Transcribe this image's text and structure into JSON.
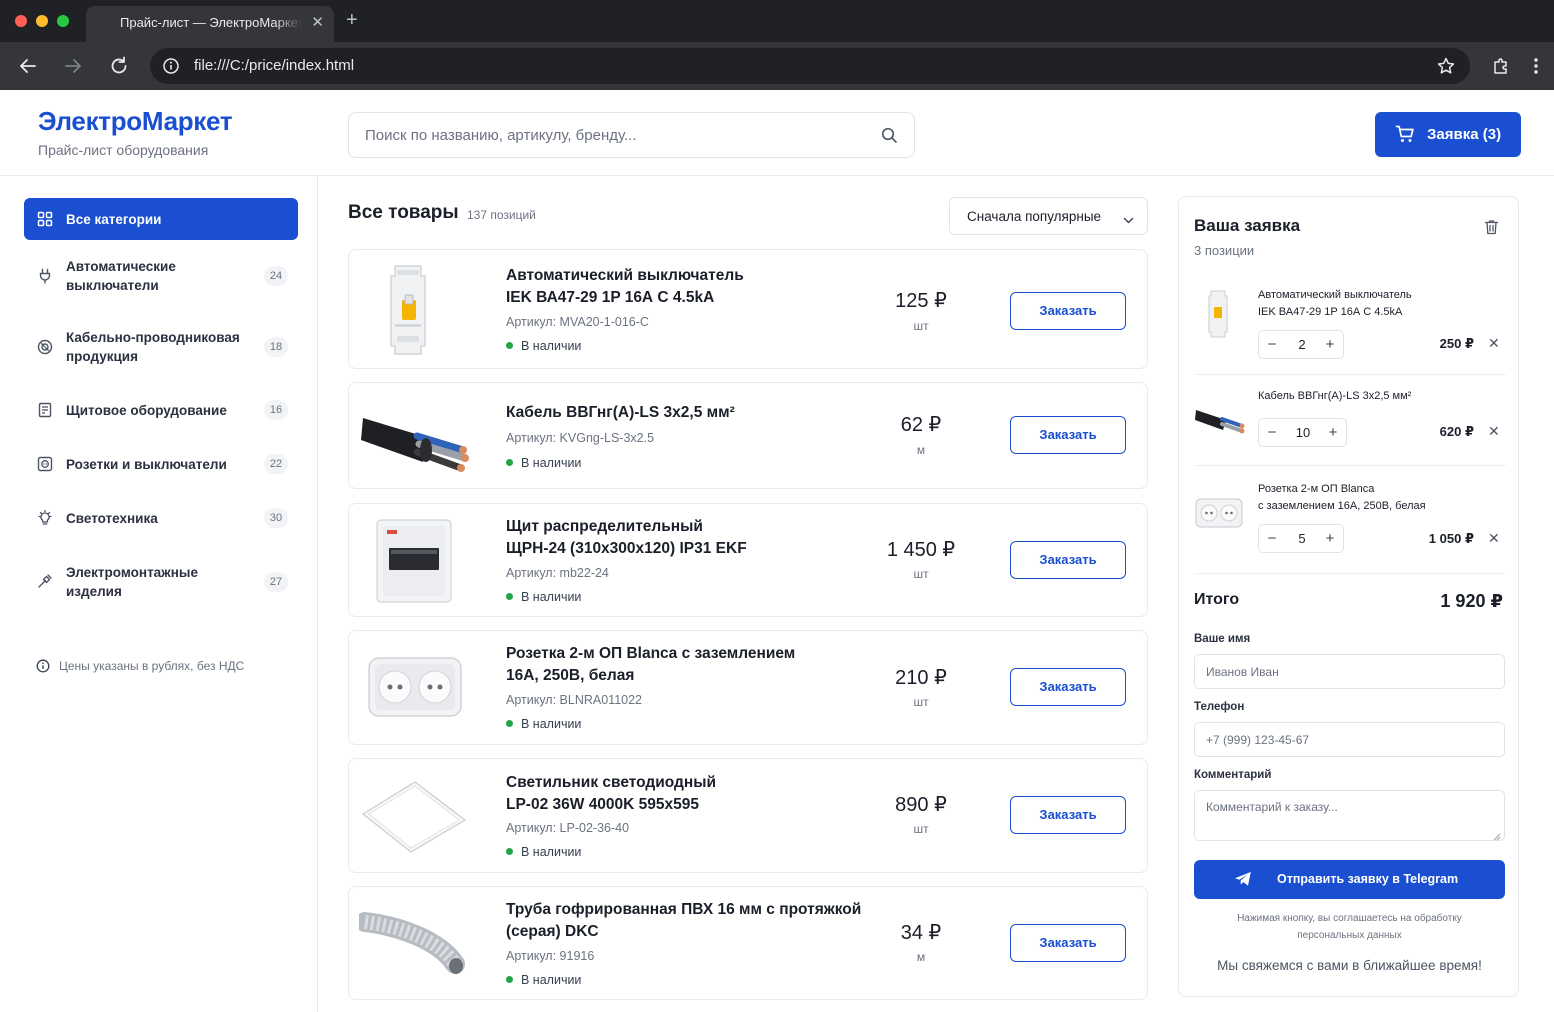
{
  "browser": {
    "tab_title": "Прайс-лист — ЭлектроМаркет",
    "tab_close": "✕",
    "new_tab": "+",
    "url": "file:///C:/price/index.html"
  },
  "header": {
    "brand": "ЭлектроМаркет",
    "subtitle": "Прайс-лист оборудования",
    "search_placeholder": "Поиск по названию, артикулу, бренду...",
    "cart_label": "Заявка (3)"
  },
  "sidebar": {
    "categories": [
      {
        "label": "Все категории",
        "count": "",
        "icon": "grid-icon",
        "active": true
      },
      {
        "label": "Автоматические выключатели",
        "count": "24",
        "icon": "plug-icon"
      },
      {
        "label": "Кабельно-проводниковая продукция",
        "count": "18",
        "icon": "cable-icon"
      },
      {
        "label": "Щитовое оборудование",
        "count": "16",
        "icon": "panel-icon"
      },
      {
        "label": "Розетки и выключатели",
        "count": "22",
        "icon": "socket-icon"
      },
      {
        "label": "Светотехника",
        "count": "30",
        "icon": "bulb-icon"
      },
      {
        "label": "Электромонтажные изделия",
        "count": "27",
        "icon": "tool-icon"
      }
    ],
    "note": "Цены указаны в рублях, без НДС"
  },
  "main": {
    "title": "Все товары",
    "count": "137 позиций",
    "sort_label": "Сначала популярные",
    "order_button": "Заказать",
    "products": [
      {
        "name_line1": "Автоматический выключатель",
        "name_line2": "IEK ВА47-29 1P 16А С 4.5kA",
        "sku": "Артикул: MVA20-1-016-C",
        "stock": "В наличии",
        "price": "125 ₽",
        "unit": "шт"
      },
      {
        "name_line1": "Кабель ВВГнг(А)-LS 3х2,5 мм²",
        "name_line2": "",
        "sku": "Артикул: KVGng-LS-3x2.5",
        "stock": "В наличии",
        "price": "62 ₽",
        "unit": "м"
      },
      {
        "name_line1": "Щит распределительный",
        "name_line2": "ЩРН-24 (310х300х120) IP31 EKF",
        "sku": "Артикул: mb22-24",
        "stock": "В наличии",
        "price": "1 450 ₽",
        "unit": "шт"
      },
      {
        "name_line1": "Розетка 2-м ОП Blanca с заземлением",
        "name_line2": "16А, 250В, белая",
        "sku": "Артикул: BLNRA011022",
        "stock": "В наличии",
        "price": "210 ₽",
        "unit": "шт"
      },
      {
        "name_line1": "Светильник светодиодный",
        "name_line2": "LP-02 36W 4000K 595х595",
        "sku": "Артикул: LP-02-36-40",
        "stock": "В наличии",
        "price": "890 ₽",
        "unit": "шт"
      },
      {
        "name_line1": "Труба гофрированная ПВХ 16 мм с протяжкой",
        "name_line2": "(серая) DKC",
        "sku": "Артикул: 91916",
        "stock": "В наличии",
        "price": "34 ₽",
        "unit": "м"
      }
    ]
  },
  "order": {
    "title": "Ваша заявка",
    "subtitle": "3 позиции",
    "items": [
      {
        "name_line1": "Автоматический выключатель",
        "name_line2": "IEK ВА47-29 1P 16А С 4.5kA",
        "qty": "2",
        "price": "250 ₽"
      },
      {
        "name_line1": "Кабель ВВГнг(А)-LS 3х2,5 мм²",
        "name_line2": "",
        "qty": "10",
        "price": "620 ₽"
      },
      {
        "name_line1": "Розетка 2-м ОП Blanca",
        "name_line2": "с заземлением 16А, 250В, белая",
        "qty": "5",
        "price": "1 050 ₽"
      }
    ],
    "total_label": "Итого",
    "total_value": "1 920 ₽",
    "name_label": "Ваше имя",
    "name_placeholder": "Иванов Иван",
    "phone_label": "Телефон",
    "phone_placeholder": "+7 (999) 123-45-67",
    "comment_label": "Комментарий",
    "comment_placeholder": "Комментарий к заказу...",
    "send_label": "Отправить заявку в Telegram",
    "consent_line1": "Нажимая кнопку, вы соглашаетесь на обработку",
    "consent_line2": "персональных данных",
    "contact_note": "Мы свяжемся с вами в ближайшее время!",
    "qty_minus": "−",
    "qty_plus": "+",
    "remove": "✕"
  },
  "colors": {
    "accent": "#1a4fd1",
    "in_stock": "#22a447",
    "border": "#e7eaf0",
    "muted_text": "#6b7280"
  }
}
